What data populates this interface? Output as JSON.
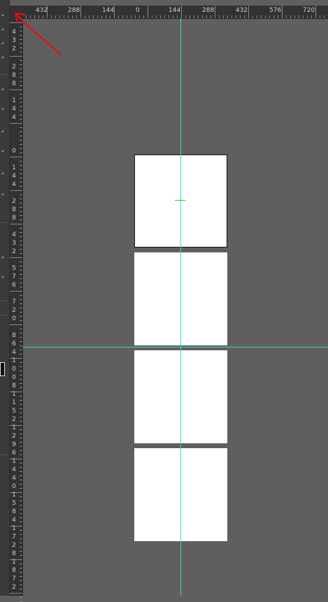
{
  "ruler_top": {
    "labels": [
      "432",
      "288",
      "144",
      "0",
      "144",
      "288",
      "432",
      "576",
      "720"
    ]
  },
  "ruler_left": {
    "groups": [
      [
        "4",
        "3",
        "2"
      ],
      [
        "2",
        "8",
        "8"
      ],
      [
        "1",
        "4",
        "4"
      ],
      [
        "0"
      ],
      [
        "1",
        "4",
        "4"
      ],
      [
        "2",
        "8",
        "8"
      ],
      [
        "4",
        "3",
        "2"
      ],
      [
        "5",
        "7",
        "6"
      ],
      [
        "7",
        "2",
        "0"
      ],
      [
        "8",
        "6",
        "4"
      ],
      [
        "1",
        "0",
        "0",
        "8"
      ],
      [
        "1",
        "1",
        "5",
        "2"
      ],
      [
        "1",
        "2",
        "9",
        "6"
      ],
      [
        "1",
        "4",
        "4",
        "0"
      ],
      [
        "1",
        "5",
        "8",
        "4"
      ],
      [
        "1",
        "7",
        "2",
        "8"
      ],
      [
        "1",
        "8",
        "7",
        "2"
      ]
    ]
  },
  "guides": {
    "color": "#3fd0d0"
  },
  "annotation": {
    "color": "#e01010"
  }
}
